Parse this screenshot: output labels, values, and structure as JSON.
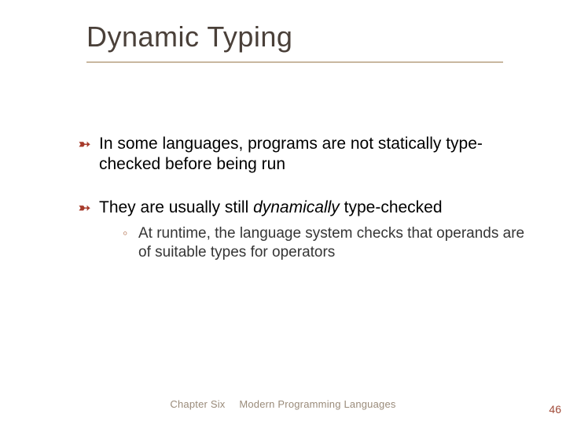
{
  "title": "Dynamic Typing",
  "bullets": [
    {
      "text": "In some languages, programs are not statically type-checked before being run",
      "subs": []
    },
    {
      "prefix": "They are usually still ",
      "em": "dynamically",
      "suffix": " type-checked",
      "subs": [
        {
          "text": "At runtime, the language system checks that operands are of suitable types for operators"
        }
      ]
    }
  ],
  "footer": {
    "chapter": "Chapter Six",
    "book": "Modern Programming Languages",
    "page": "46"
  }
}
